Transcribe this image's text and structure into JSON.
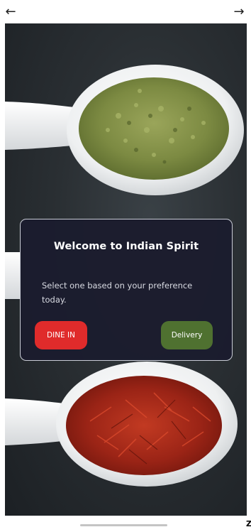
{
  "nav": {
    "back_icon": "arrow-left-icon",
    "forward_icon": "arrow-right-icon",
    "back_glyph": "←",
    "forward_glyph": "→"
  },
  "welcome_dialog": {
    "title": "Welcome to Indian Spirit",
    "message": "Select one based on your preference today.",
    "dine_in_label": "DINE IN",
    "delivery_label": "Delivery"
  },
  "corner_text": "Z",
  "colors": {
    "dialog_bg": "#1b1c2e",
    "dine_in": "#e02b2b",
    "delivery": "#4f7130",
    "background_slate": "#2a2f33"
  }
}
